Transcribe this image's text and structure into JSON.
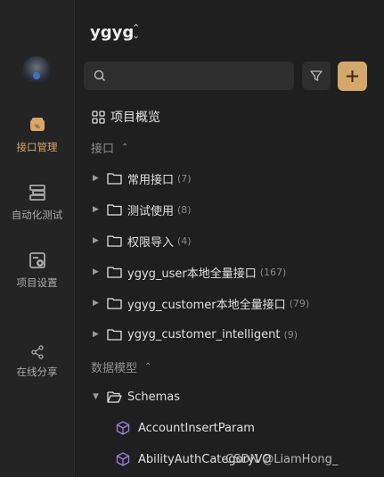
{
  "rail": {
    "items": [
      {
        "label": "接口管理",
        "icon": "api-icon",
        "active": true
      },
      {
        "label": "自动化测试",
        "icon": "automation-icon",
        "active": false
      },
      {
        "label": "项目设置",
        "icon": "settings-icon",
        "active": false
      },
      {
        "label": "在线分享",
        "icon": "share-icon",
        "active": false
      }
    ]
  },
  "project": {
    "name": "ygyg"
  },
  "search": {
    "placeholder": ""
  },
  "overview": {
    "label": "项目概览"
  },
  "interfaces": {
    "heading": "接口",
    "folders": [
      {
        "name": "常用接口",
        "count": "(7)"
      },
      {
        "name": "测试使用",
        "count": "(8)"
      },
      {
        "name": "权限导入",
        "count": "(4)"
      },
      {
        "name": "ygyg_user本地全量接口",
        "count": "(167)"
      },
      {
        "name": "ygyg_customer本地全量接口",
        "count": "(79)"
      },
      {
        "name": "ygyg_customer_intelligent",
        "count": "(9)"
      }
    ]
  },
  "models": {
    "heading": "数据模型",
    "folder": "Schemas",
    "items": [
      "AccountInsertParam",
      "AbilityAuthCategoryVO"
    ]
  },
  "watermark": "CSDN @LiamHong_",
  "colors": {
    "accent": "#d3a86a",
    "background": "#1f1f1f",
    "rail": "#242424",
    "schema_icon": "#9b7fe0"
  }
}
